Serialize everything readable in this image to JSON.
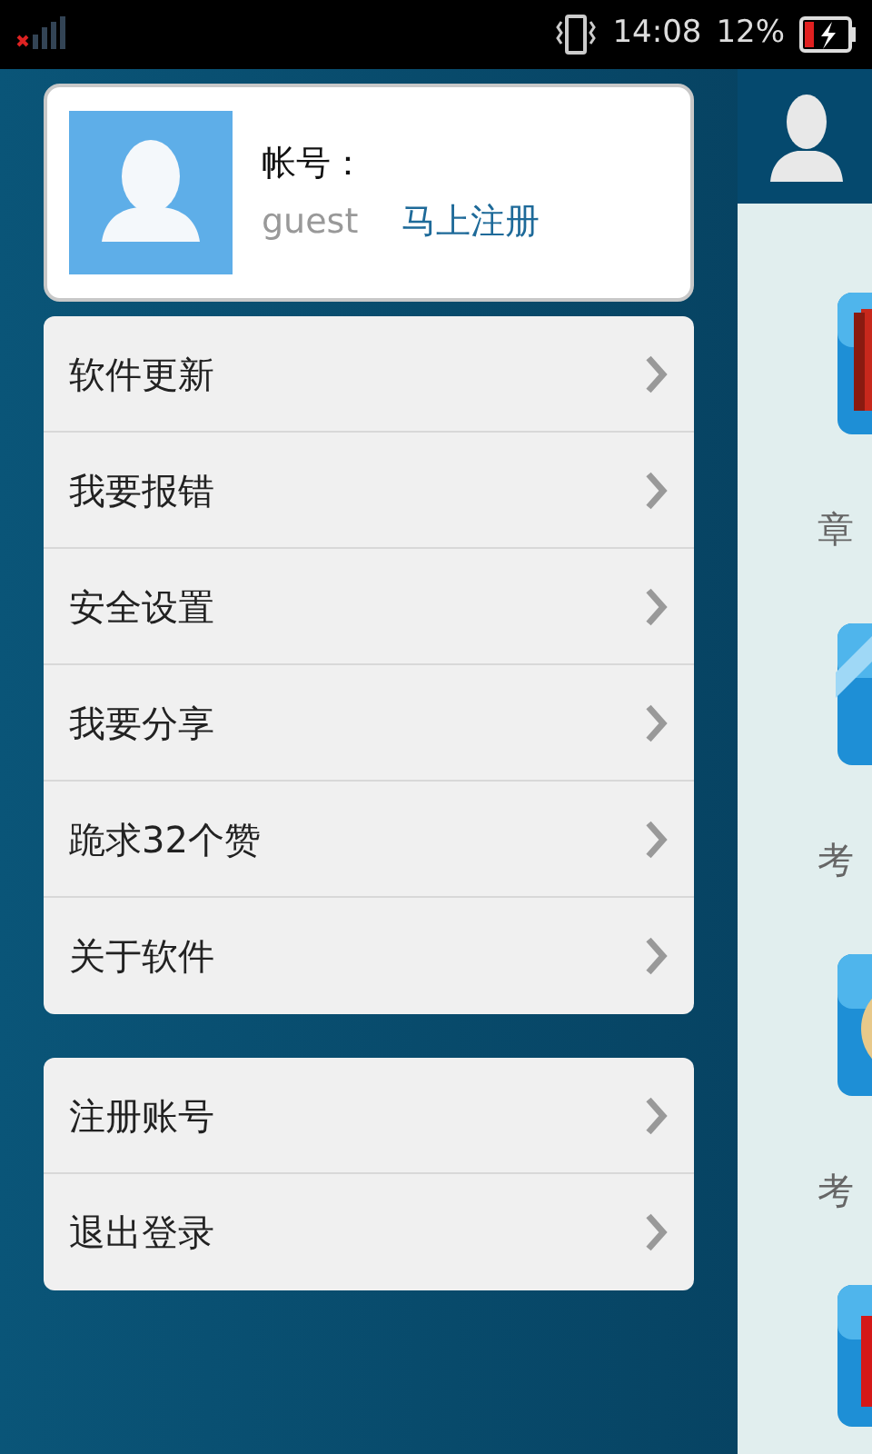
{
  "status_bar": {
    "time": "14:08",
    "battery": "12%"
  },
  "profile": {
    "account_label": "帐号：",
    "username": "guest",
    "register_link": "马上注册"
  },
  "menu_groups": [
    {
      "items": [
        {
          "label": "软件更新"
        },
        {
          "label": "我要报错"
        },
        {
          "label": "安全设置"
        },
        {
          "label": "我要分享"
        },
        {
          "label": "跪求32个赞"
        },
        {
          "label": "关于软件"
        }
      ]
    },
    {
      "items": [
        {
          "label": "注册账号"
        },
        {
          "label": "退出登录"
        }
      ]
    }
  ],
  "content_items": [
    {
      "kind": "book",
      "label": "章"
    },
    {
      "kind": "vip",
      "label": "考"
    },
    {
      "kind": "medal",
      "label": "考"
    },
    {
      "kind": "red"
    }
  ]
}
